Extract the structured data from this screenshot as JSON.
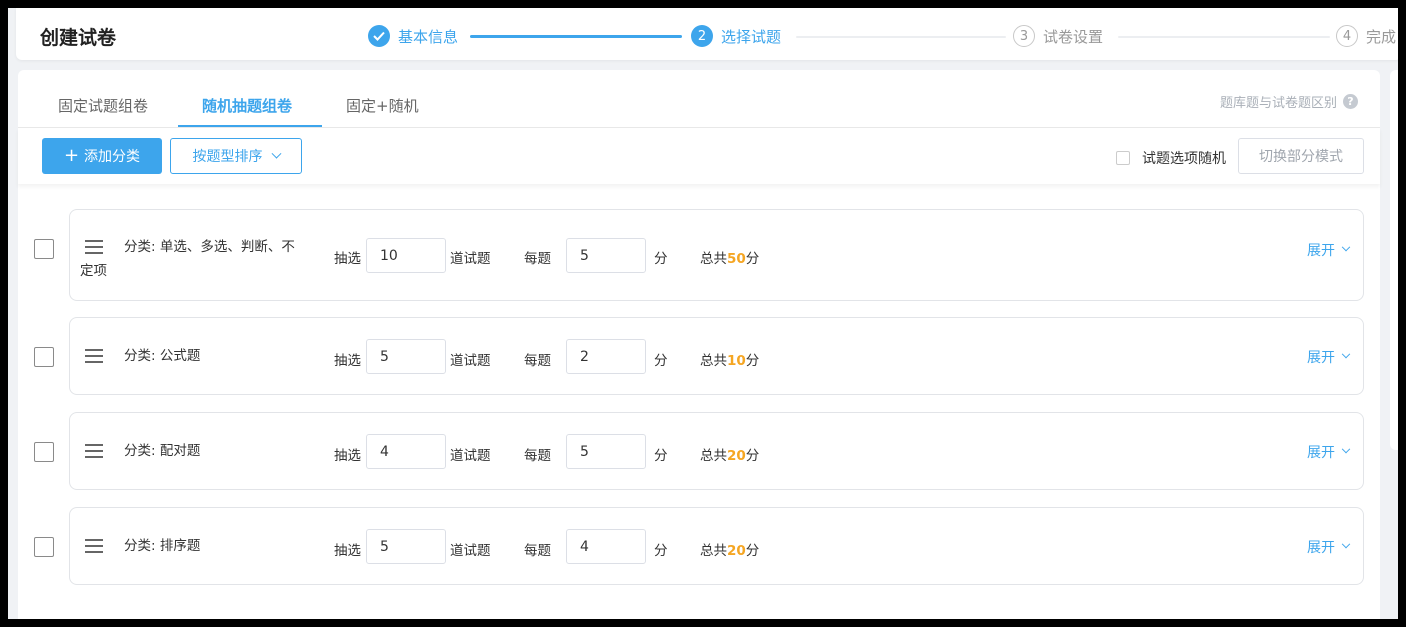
{
  "header": {
    "title": "创建试卷",
    "steps": [
      {
        "label": "基本信息",
        "state": "done"
      },
      {
        "number": "2",
        "label": "选择试题",
        "state": "active"
      },
      {
        "number": "3",
        "label": "试卷设置",
        "state": "pending"
      },
      {
        "number": "4",
        "label": "完成",
        "state": "pending"
      }
    ]
  },
  "tabs": [
    "固定试题组卷",
    "随机抽题组卷",
    "固定+随机"
  ],
  "active_tab": "随机抽题组卷",
  "help_link": "题库题与试卷题区别",
  "help_icon": "?",
  "toolbar": {
    "add_plus": "+",
    "add_category": "添加分类",
    "sort_by_type": "按题型排序",
    "random_options_label": "试题选项随机",
    "switch_mode": "切换部分模式"
  },
  "row_texts": {
    "pick": "抽选",
    "questions": "道试题",
    "each": "每题",
    "score_unit": "分",
    "total_prefix": "总共",
    "total_suffix": "分",
    "expand": "展开"
  },
  "categories": [
    {
      "label_line1": "分类: 单选、多选、判断、不",
      "label_line2": "定项",
      "count": "10",
      "score": "5",
      "total": "50"
    },
    {
      "label_line1": "分类: 公式题",
      "label_line2": "",
      "count": "5",
      "score": "2",
      "total": "10"
    },
    {
      "label_line1": "分类: 配对题",
      "label_line2": "",
      "count": "4",
      "score": "5",
      "total": "20"
    },
    {
      "label_line1": "分类: 排序题",
      "label_line2": "",
      "count": "5",
      "score": "4",
      "total": "20"
    }
  ],
  "colors": {
    "primary": "#3da5ec",
    "highlight": "#f5a623"
  }
}
